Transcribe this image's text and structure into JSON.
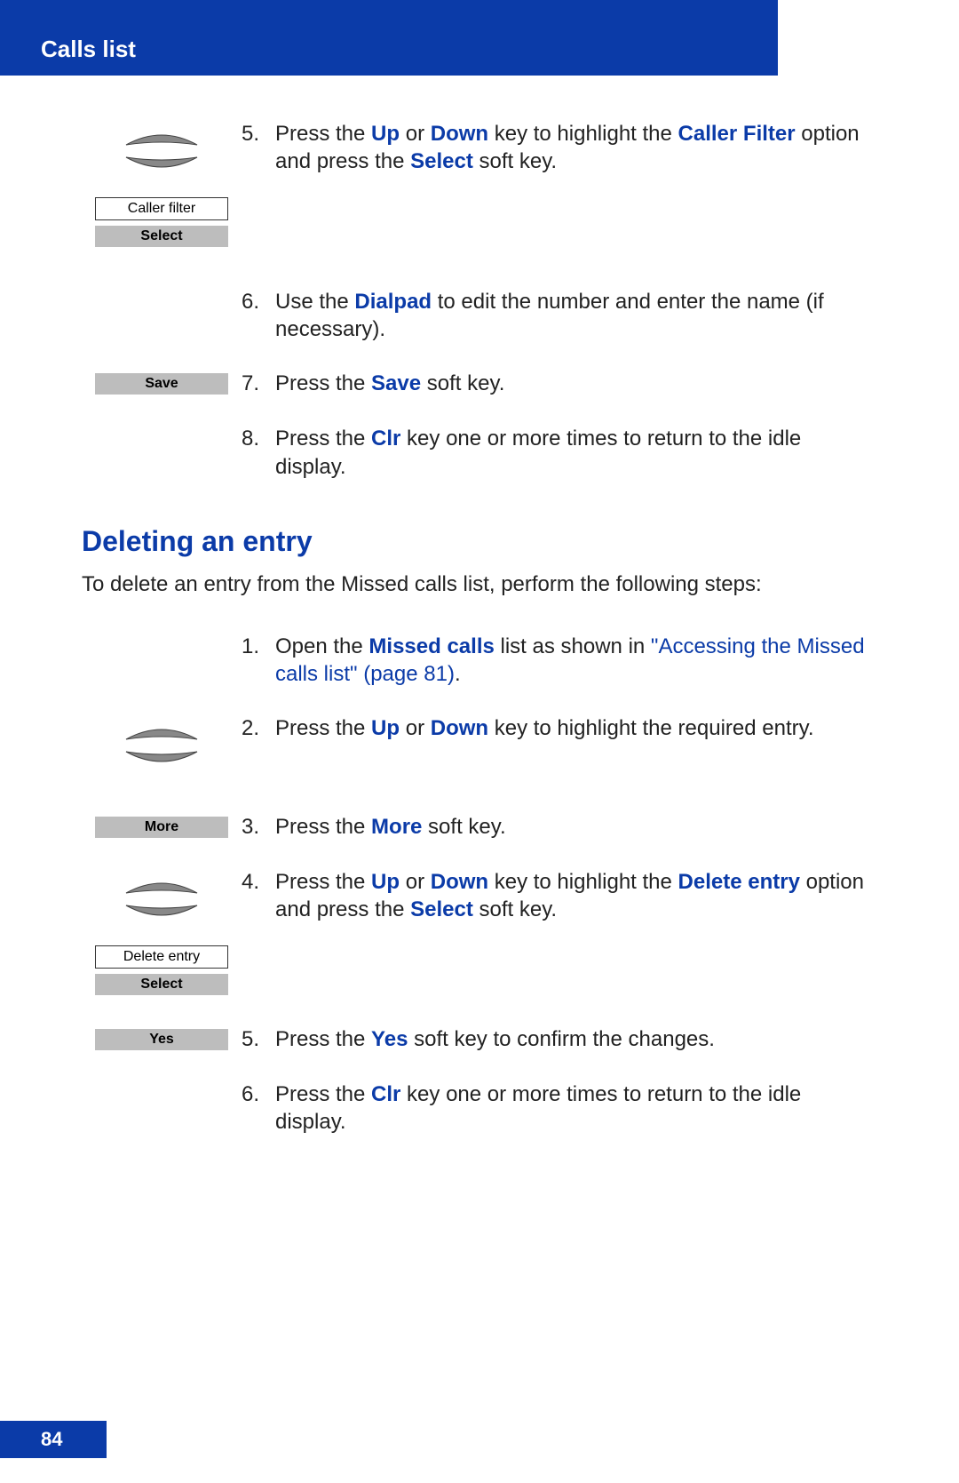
{
  "header": {
    "title": "Calls list"
  },
  "pageNumber": "84",
  "section1": {
    "icons": {
      "callerFilterMenu": "Caller filter",
      "selectKey": "Select",
      "saveKey": "Save"
    },
    "steps": [
      {
        "num": "5.",
        "parts": [
          {
            "t": "Press the "
          },
          {
            "t": "Up",
            "b": true
          },
          {
            "t": " or "
          },
          {
            "t": "Down",
            "b": true
          },
          {
            "t": " key to highlight the "
          },
          {
            "t": "Caller Filter",
            "b": true
          },
          {
            "t": " option and press the "
          },
          {
            "t": "Select",
            "b": true
          },
          {
            "t": " soft key."
          }
        ]
      },
      {
        "num": "6.",
        "parts": [
          {
            "t": "Use the "
          },
          {
            "t": "Dialpad",
            "b": true
          },
          {
            "t": " to edit the number and enter the name (if necessary)."
          }
        ]
      },
      {
        "num": "7.",
        "parts": [
          {
            "t": "Press the "
          },
          {
            "t": "Save",
            "b": true
          },
          {
            "t": " soft key."
          }
        ]
      },
      {
        "num": "8.",
        "parts": [
          {
            "t": "Press the "
          },
          {
            "t": "Clr",
            "b": true
          },
          {
            "t": " key one or more times to return to the idle display."
          }
        ]
      }
    ]
  },
  "section2": {
    "title": "Deleting an entry",
    "intro": "To delete an entry from the Missed calls list, perform the following steps:",
    "icons": {
      "moreKey": "More",
      "deleteEntryMenu": "Delete entry",
      "selectKey": "Select",
      "yesKey": "Yes"
    },
    "steps": [
      {
        "num": "1.",
        "parts": [
          {
            "t": "Open the "
          },
          {
            "t": "Missed calls",
            "b": true
          },
          {
            "t": " list as shown in "
          },
          {
            "t": "\"Accessing the Missed calls list\" (page 81)",
            "link": true
          },
          {
            "t": "."
          }
        ]
      },
      {
        "num": "2.",
        "parts": [
          {
            "t": "Press the "
          },
          {
            "t": "Up",
            "b": true
          },
          {
            "t": " or "
          },
          {
            "t": "Down",
            "b": true
          },
          {
            "t": " key to highlight the required entry."
          }
        ]
      },
      {
        "num": "3.",
        "parts": [
          {
            "t": "Press the "
          },
          {
            "t": "More",
            "b": true
          },
          {
            "t": " soft key."
          }
        ]
      },
      {
        "num": "4.",
        "parts": [
          {
            "t": "Press the "
          },
          {
            "t": "Up",
            "b": true
          },
          {
            "t": " or "
          },
          {
            "t": "Down",
            "b": true
          },
          {
            "t": " key to highlight the "
          },
          {
            "t": "Delete entry",
            "b": true
          },
          {
            "t": " option and press the "
          },
          {
            "t": "Select",
            "b": true
          },
          {
            "t": " soft key."
          }
        ]
      },
      {
        "num": "5.",
        "parts": [
          {
            "t": "Press the "
          },
          {
            "t": "Yes",
            "b": true
          },
          {
            "t": " soft key to confirm the changes."
          }
        ]
      },
      {
        "num": "6.",
        "parts": [
          {
            "t": "Press the "
          },
          {
            "t": "Clr",
            "b": true
          },
          {
            "t": " key one or more times to return to the idle display."
          }
        ]
      }
    ]
  }
}
